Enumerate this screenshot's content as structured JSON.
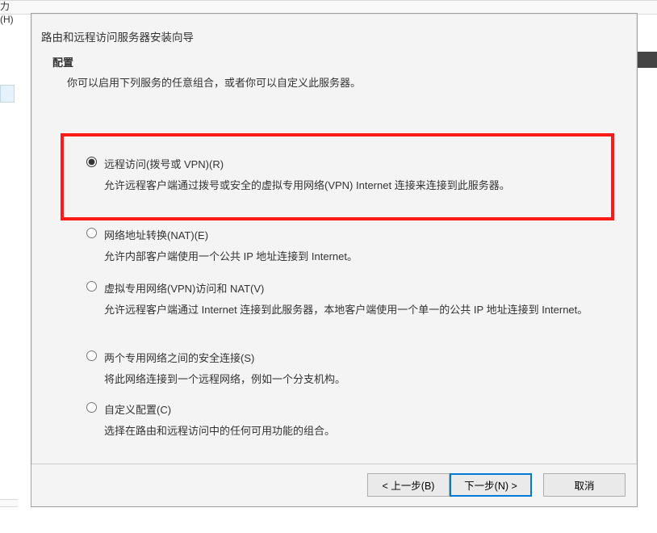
{
  "fragments": {
    "help": "力(H)"
  },
  "wizard": {
    "title": "路由和远程访问服务器安装向导",
    "heading": "配置",
    "sub": "你可以启用下列服务的任意组合，或者你可以自定义此服务器。"
  },
  "options": [
    {
      "checked": true,
      "label": "远程访问(拨号或 VPN)(R)",
      "desc": "允许远程客户端通过拨号或安全的虚拟专用网络(VPN) Internet 连接来连接到此服务器。"
    },
    {
      "checked": false,
      "label": "网络地址转换(NAT)(E)",
      "desc": "允许内部客户端使用一个公共 IP 地址连接到 Internet。"
    },
    {
      "checked": false,
      "label": "虚拟专用网络(VPN)访问和 NAT(V)",
      "desc": "允许远程客户端通过 Internet 连接到此服务器，本地客户端使用一个单一的公共 IP 地址连接到 Internet。"
    },
    {
      "checked": false,
      "label": "两个专用网络之间的安全连接(S)",
      "desc": "将此网络连接到一个远程网络，例如一个分支机构。"
    },
    {
      "checked": false,
      "label": "自定义配置(C)",
      "desc": "选择在路由和远程访问中的任何可用功能的组合。"
    }
  ],
  "buttons": {
    "back": "< 上一步(B)",
    "next": "下一步(N) >",
    "cancel": "取消"
  }
}
